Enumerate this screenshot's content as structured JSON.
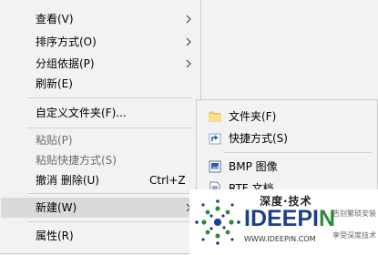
{
  "context_menu": {
    "items": [
      {
        "label": "查看(V)",
        "submenu": true
      },
      {
        "label": "排序方式(O)",
        "submenu": true
      },
      {
        "label": "分组依据(P)",
        "submenu": true
      },
      {
        "label": "刷新(E)"
      },
      {
        "label": "自定义文件夹(F)..."
      },
      {
        "label": "粘贴(P)",
        "disabled": true
      },
      {
        "label": "粘贴快捷方式(S)",
        "disabled": true
      },
      {
        "label": "撤消 删除(U)",
        "shortcut": "Ctrl+Z"
      },
      {
        "label": "新建(W)",
        "submenu": true
      },
      {
        "label": "属性(R)"
      }
    ]
  },
  "new_submenu": {
    "items": [
      {
        "label": "文件夹(F)",
        "icon": "folder-icon"
      },
      {
        "label": "快捷方式(S)",
        "icon": "shortcut-icon"
      },
      {
        "label": "BMP 图像",
        "icon": "bmp-image-icon"
      },
      {
        "label": "RTF 文档",
        "icon": "rtf-document-icon"
      }
    ]
  },
  "watermark": {
    "top_text": "深度·技术",
    "brand_main": "IDEEPI",
    "brand_accent": "N",
    "right_top": "告别繁琐安装",
    "right_bottom": "享受深度技术",
    "url": "WWW.IDEEPIN.COM"
  },
  "colors": {
    "menu_bg": "#f2f2f2",
    "hover_bg": "#dadada",
    "separator": "#d0d0d0",
    "disabled_text": "#6d6d6d",
    "brand_blue": "#1d3f88",
    "brand_green": "#2f8a3c"
  }
}
